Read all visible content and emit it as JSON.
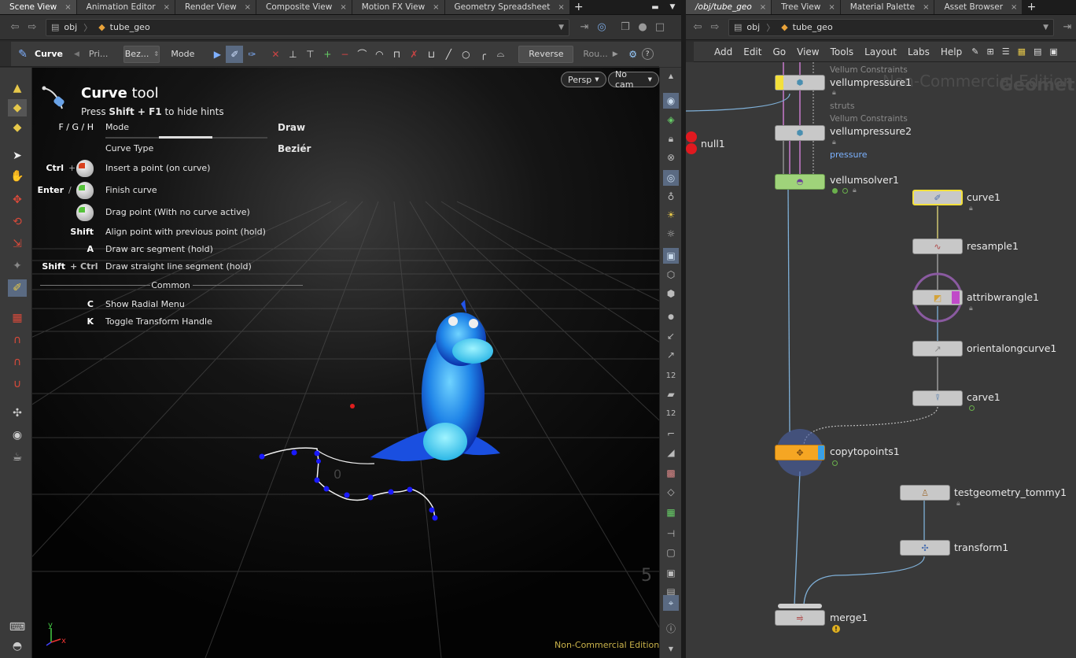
{
  "left_tabs": [
    {
      "label": "Scene View"
    },
    {
      "label": "Animation Editor"
    },
    {
      "label": "Render View"
    },
    {
      "label": "Composite View"
    },
    {
      "label": "Motion FX View"
    },
    {
      "label": "Geometry Spreadsheet"
    }
  ],
  "right_tabs": [
    {
      "label": "/obj/tube_geo"
    },
    {
      "label": "Tree View"
    },
    {
      "label": "Material Palette"
    },
    {
      "label": "Asset Browser"
    }
  ],
  "left_path": {
    "root": "obj",
    "node": "tube_geo"
  },
  "right_path": {
    "root": "obj",
    "node": "tube_geo"
  },
  "toolbar": {
    "tool_name": "Curve",
    "primitive_label": "Pri...",
    "curve_type_dropdown": "Bez...",
    "mode_label": "Mode",
    "reverse_label": "Reverse",
    "rounding_label": "Rou..."
  },
  "viewport": {
    "camera_persp": "Persp",
    "camera_nocam": "No cam",
    "watermark": "Non-Commercial Edition",
    "grid_label_near": "0",
    "grid_label_far": "5",
    "axis_y": "y",
    "axis_x": "x"
  },
  "hints": {
    "title_bold": "Curve",
    "title_rest": "tool",
    "subtitle_pre": "Press",
    "subtitle_key": "Shift + F1",
    "subtitle_post": "to hide hints",
    "mode_keys": "F / G / H",
    "mode_label": "Mode",
    "mode_value": "Draw",
    "curve_type_label": "Curve Type",
    "curve_type_value": "Beziér",
    "rows": [
      {
        "key": "Ctrl",
        "plus": "+",
        "text": "Insert a point (on curve)"
      },
      {
        "key": "Enter",
        "plus": "/",
        "text": "Finish curve"
      },
      {
        "key": "",
        "plus": "",
        "text": "Drag point (With no curve active)"
      },
      {
        "key": "Shift",
        "plus": "",
        "text": "Align point with previous point (hold)"
      },
      {
        "key": "A",
        "plus": "",
        "text": "Draw arc segment (hold)"
      },
      {
        "key": "Shift",
        "plus": "+ Ctrl",
        "text": "Draw straight line segment (hold)"
      }
    ],
    "common_label": "Common",
    "common_rows": [
      {
        "key": "C",
        "text": "Show Radial Menu"
      },
      {
        "key": "K",
        "text": "Toggle Transform Handle"
      }
    ]
  },
  "net_menu": [
    "Add",
    "Edit",
    "Go",
    "View",
    "Tools",
    "Layout",
    "Labs",
    "Help"
  ],
  "network": {
    "watermark_edition": "Non-Commercial Edition",
    "watermark_context": "Geometry",
    "nodes": {
      "vellumpressure1": {
        "label": "vellumpressure1",
        "sub": "Vellum Constraints",
        "group": "struts"
      },
      "vellumpressure2": {
        "label": "vellumpressure2",
        "sub": "Vellum Constraints",
        "group": "pressure"
      },
      "vellumsolver1": {
        "label": "vellumsolver1"
      },
      "null1": {
        "label": "null1"
      },
      "curve1": {
        "label": "curve1"
      },
      "resample1": {
        "label": "resample1"
      },
      "attribwrangle1": {
        "label": "attribwrangle1"
      },
      "orientalongcurve1": {
        "label": "orientalongcurve1"
      },
      "carve1": {
        "label": "carve1"
      },
      "copytopoints1": {
        "label": "copytopoints1"
      },
      "testgeometry_tommy1": {
        "label": "testgeometry_tommy1"
      },
      "transform1": {
        "label": "transform1"
      },
      "merge1": {
        "label": "merge1"
      }
    }
  },
  "colors": {
    "curve_point": "#1a1aff",
    "vellumsolver_node": "#9fd37a",
    "copytopoints_node": "#f5a623",
    "attribwrangle_ring": "#8a5aa0",
    "selected_outline": "#f3e03b",
    "null_node": "#e0191f"
  }
}
